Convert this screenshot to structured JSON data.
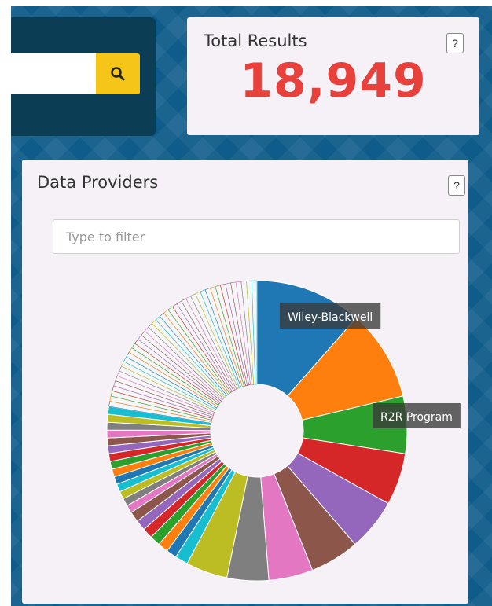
{
  "search": {
    "value": "",
    "placeholder": ""
  },
  "total": {
    "title": "Total Results",
    "value": "18,949",
    "help": "?"
  },
  "providers": {
    "title": "Data Providers",
    "help": "?",
    "filter_placeholder": "Type to filter"
  },
  "chart_data": {
    "type": "pie",
    "donut": true,
    "labels": [
      "Wiley-Blackwell",
      "R2R Program"
    ],
    "values": [
      41,
      35,
      22,
      20,
      20,
      19,
      17,
      16,
      16,
      5,
      4,
      4,
      4,
      4,
      4,
      4,
      3,
      3,
      3,
      3,
      3,
      3,
      3,
      3,
      3,
      3,
      3,
      3,
      3,
      3,
      2,
      2,
      2,
      2,
      2,
      2,
      2,
      2,
      2,
      2,
      2,
      2,
      2,
      2,
      2,
      2,
      2,
      2,
      2,
      2,
      2,
      2,
      2,
      2,
      2,
      2,
      2,
      2,
      2,
      2,
      2,
      2,
      2,
      2,
      2,
      2,
      2,
      2,
      2,
      2
    ],
    "palette": [
      "#1f77b4",
      "#ff7f0e",
      "#2ca02c",
      "#d62728",
      "#9467bd",
      "#8c564b",
      "#e377c2",
      "#7f7f7f",
      "#bcbd22",
      "#17becf"
    ],
    "thin_slice_fill": "#f6f6f8"
  }
}
